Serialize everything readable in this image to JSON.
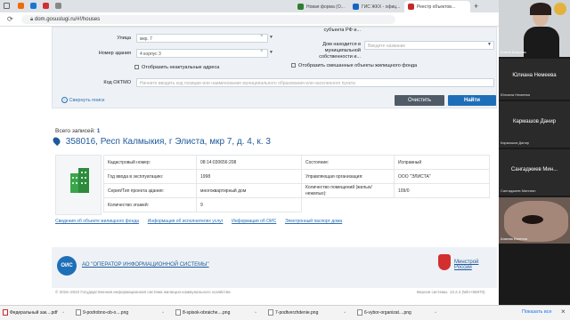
{
  "browser": {
    "tabs": [
      {
        "label": "Новая форма (О...",
        "icon_color": "#2e7d32",
        "active": false
      },
      {
        "label": "ГИС ЖКХ - офиц...",
        "icon_color": "#1565c0",
        "active": false
      },
      {
        "label": "Реестр объектов...",
        "icon_color": "#c62828",
        "active": true
      }
    ],
    "url": "dom.gosuslugi.ru/#!/houses"
  },
  "search_form": {
    "street_label": "Улица",
    "street_value": "мкр. 7",
    "house_label": "Номер здания",
    "house_value": "4 корпус 3",
    "subject_tail": "субъекта РФ и...",
    "house_in_mun_label": "Дом находится в муниципальной собственности и...",
    "house_in_mun_placeholder": "Введите название",
    "irrelevant_checkbox": "Отобразить неактуальные адреса",
    "mixed_checkbox": "Отобразить смешанные объекты жилищного фонда",
    "oktmo_label": "Код ОКТМО",
    "oktmo_placeholder": "Начните вводить код позиции или наименование муниципального образования или населенного пункта",
    "collapse_link": "Свернуть поиск",
    "clear_button": "Очистить",
    "find_button": "Найти"
  },
  "results": {
    "total_label": "Всего записей:",
    "total_value": "1",
    "address": "358016, Респ Калмыкия, г Элиста, мкр 7, д. 4, к. 3",
    "table": [
      {
        "l1": "Кадастровый номер:",
        "v1": "08:14:030656:208",
        "l2": "Состояние:",
        "v2": "Исправный"
      },
      {
        "l1": "Год ввода в эксплуатацию:",
        "v1": "1998",
        "l2": "Управляющая организация:",
        "v2": "ООО \"ЭЛИСТА\""
      },
      {
        "l1": "Серия/Тип проекта здания:",
        "v1": "многоквартирный дом",
        "l2": "Количество помещений (жилых/нежилых):",
        "v2": "109/0"
      },
      {
        "l1": "Количество этажей:",
        "v1": "9",
        "l2": "",
        "v2": ""
      }
    ],
    "links": [
      "Сведения об объекте жилищного фонда",
      "Информация об исполнителях услуг",
      "Информация об ОИС",
      "Электронный паспорт дома"
    ]
  },
  "footer": {
    "operator_badge": "ОИС",
    "operator_name": "АО \"ОПЕРАТОР ИНФОРМАЦИОННОЙ СИСТЕМЫ\"",
    "ministry_name": "Минстрой России",
    "copyright": "© 2016–2022 Государственная информационная система жилищно-коммунального хозяйства",
    "version": "Версия системы: 13.2.4 (Win+56970)"
  },
  "participants": {
    "speaker_caption": "Елена Клыкова",
    "tiles": [
      {
        "name": "Юлиана Немеева",
        "small": "Юлиана Немеева"
      },
      {
        "name": "Кармашов Данир",
        "small": "Кармашов Данир"
      },
      {
        "name": "Сангаджиев Мин...",
        "small": "Сангаджиев Мингиян"
      },
      {
        "name": "",
        "small": "Алиева Евгения"
      }
    ]
  },
  "taskbar": {
    "items": [
      "Федеральный зак....pdf",
      "9-podrobno-ob-o....png",
      "8-spisok-obraiche....png",
      "7-podtverzhdenie.png",
      "6-vybor-organizat....png"
    ],
    "show_all": "Показать все",
    "close": "×"
  },
  "colors": {
    "accent": "#2b6fb3",
    "find_button": "#1e6fb8",
    "clear_button": "#4f5b66",
    "address": "#1e5a9a"
  }
}
